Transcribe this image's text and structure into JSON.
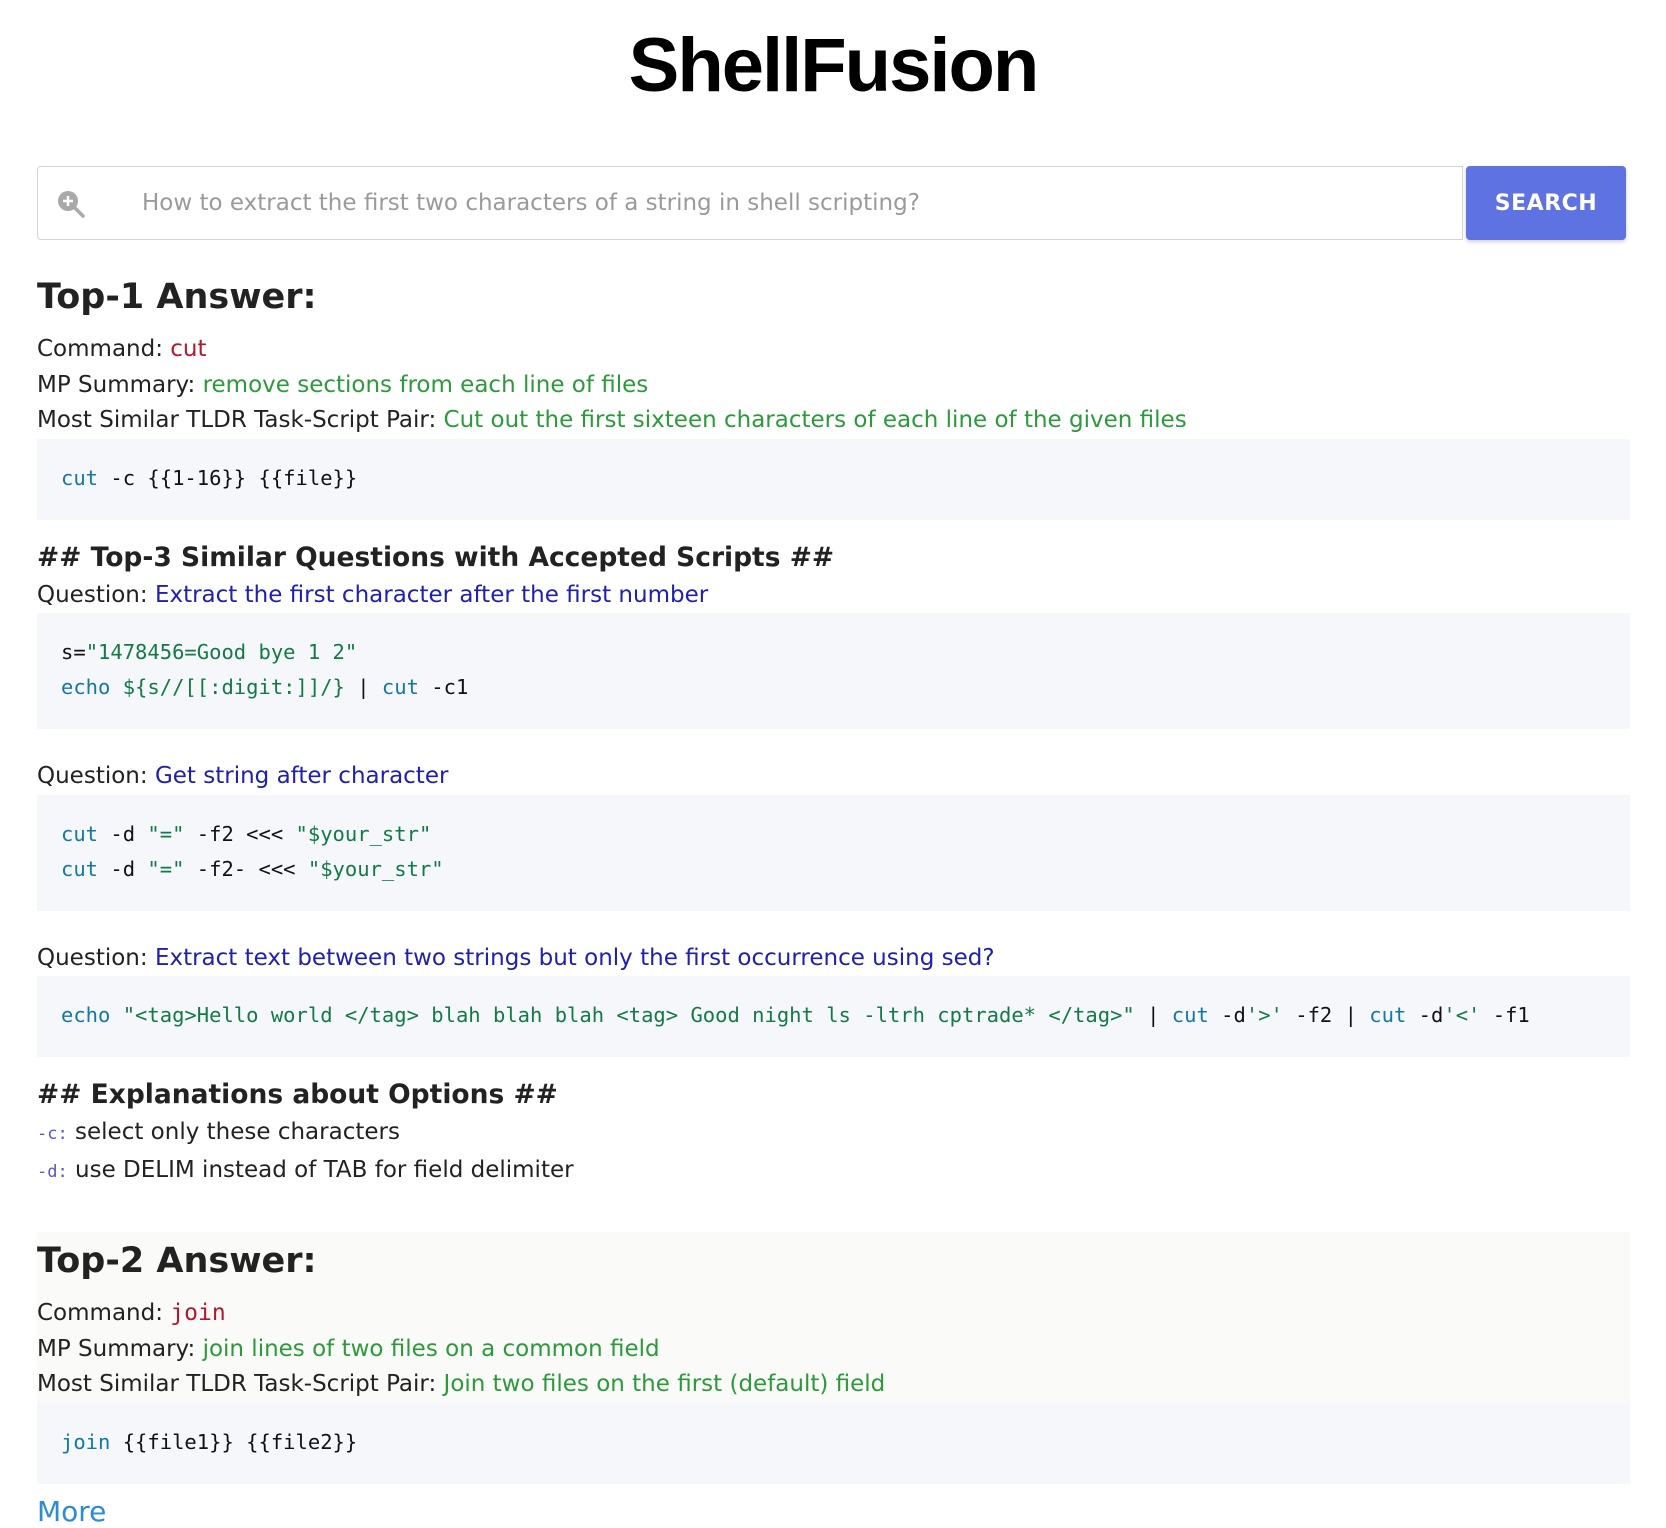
{
  "app": {
    "title": "ShellFusion"
  },
  "search": {
    "placeholder": "How to extract the first two characters of a string in shell scripting?",
    "button_label": "SEARCH"
  },
  "labels": {
    "command": "Command: ",
    "mp_summary": "MP Summary: ",
    "tldr_pair": "Most Similar TLDR Task-Script Pair: ",
    "question": "Question: ",
    "similar_heading": "## Top-3 Similar Questions with Accepted Scripts ##",
    "options_heading": "## Explanations about Options ##"
  },
  "top1": {
    "heading": "Top-1 Answer:",
    "command": "cut",
    "mp_summary": "remove sections from each line of files",
    "tldr_task": "Cut out the first sixteen characters of each line of the given files",
    "tldr_script": {
      "kw": "cut",
      "rest": " -c {{1-16}} {{file}}"
    },
    "questions": [
      {
        "title": "Extract the first character after the first number"
      },
      {
        "title": "Get string after character"
      },
      {
        "title": "Extract text between two strings but only the first occurrence using sed?"
      }
    ],
    "scripts": {
      "q1l1a": "s=",
      "q1l1b": "\"1478456=Good bye 1 2\"",
      "q1l2a": "echo",
      "q1l2b": " ${s//[[:digit:]]/}",
      "q1l2c": " | ",
      "q1l2d": "cut",
      "q1l2e": " -c1",
      "q2l1a": "cut",
      "q2l1b": " -d ",
      "q2l1c": "\"=\"",
      "q2l1d": " -f2 <<< ",
      "q2l1e": "\"$your_str\"",
      "q2l2a": "cut",
      "q2l2b": " -d ",
      "q2l2c": "\"=\"",
      "q2l2d": " -f2- <<< ",
      "q2l2e": "\"$your_str\"",
      "q3a": "echo",
      "q3b": " \"<tag>Hello world </tag> blah blah blah <tag> Good night ls -ltrh cptrade* </tag>\"",
      "q3c": " | ",
      "q3d": "cut",
      "q3e": " -d",
      "q3f": "'>'",
      "q3g": " -f2 | ",
      "q3h": "cut",
      "q3i": " -d",
      "q3j": "'<'",
      "q3k": " -f1"
    },
    "options": [
      {
        "flag": "-c:",
        "desc": "select only these characters"
      },
      {
        "flag": "-d:",
        "desc": "use DELIM instead of TAB for field delimiter"
      }
    ]
  },
  "top2": {
    "heading": "Top-2 Answer:",
    "command": "join",
    "mp_summary": "join lines of two files on a common field",
    "tldr_task": "Join two files on the first (default) field",
    "tldr_script": {
      "kw": "join",
      "rest": " {{file1}} {{file2}}"
    }
  },
  "more_label": "More",
  "colors": {
    "accent": "#5f72e2",
    "command": "#b5172c",
    "summary": "#2b9a3a",
    "question": "#2020b0",
    "link": "#2b8bd6"
  }
}
